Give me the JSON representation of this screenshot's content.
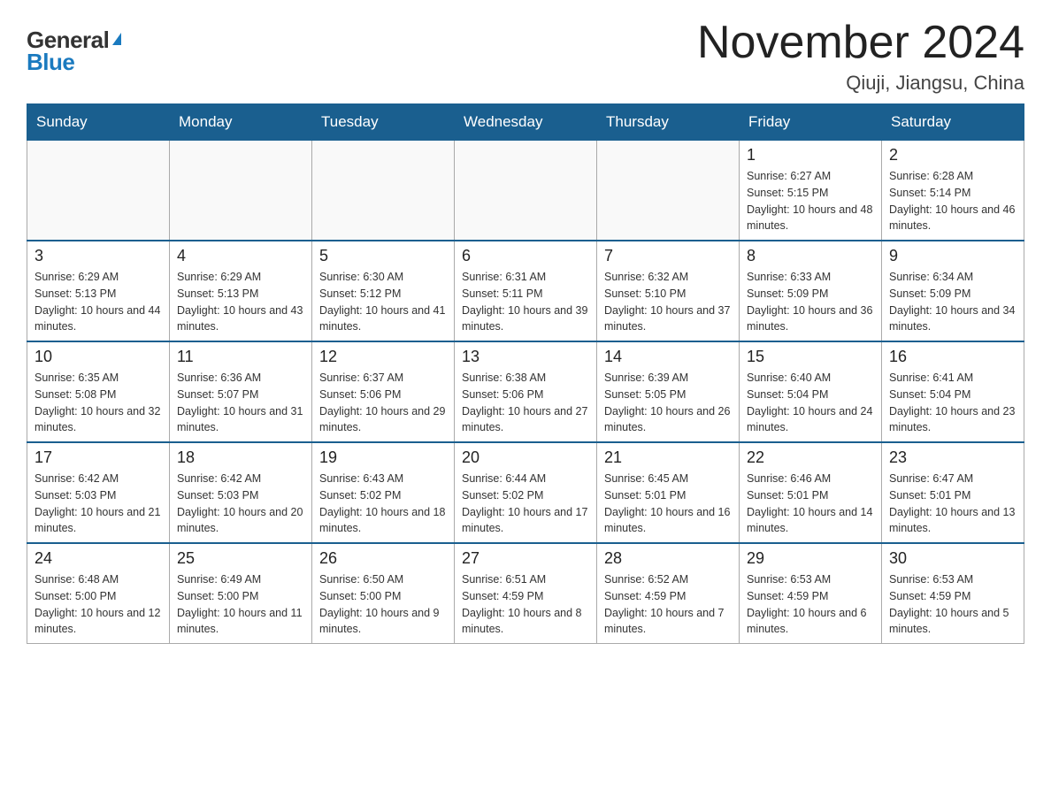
{
  "header": {
    "logo_general": "General",
    "logo_blue": "Blue",
    "month_title": "November 2024",
    "location": "Qiuji, Jiangsu, China"
  },
  "days_of_week": [
    "Sunday",
    "Monday",
    "Tuesday",
    "Wednesday",
    "Thursday",
    "Friday",
    "Saturday"
  ],
  "weeks": [
    [
      {
        "day": "",
        "info": ""
      },
      {
        "day": "",
        "info": ""
      },
      {
        "day": "",
        "info": ""
      },
      {
        "day": "",
        "info": ""
      },
      {
        "day": "",
        "info": ""
      },
      {
        "day": "1",
        "info": "Sunrise: 6:27 AM\nSunset: 5:15 PM\nDaylight: 10 hours and 48 minutes."
      },
      {
        "day": "2",
        "info": "Sunrise: 6:28 AM\nSunset: 5:14 PM\nDaylight: 10 hours and 46 minutes."
      }
    ],
    [
      {
        "day": "3",
        "info": "Sunrise: 6:29 AM\nSunset: 5:13 PM\nDaylight: 10 hours and 44 minutes."
      },
      {
        "day": "4",
        "info": "Sunrise: 6:29 AM\nSunset: 5:13 PM\nDaylight: 10 hours and 43 minutes."
      },
      {
        "day": "5",
        "info": "Sunrise: 6:30 AM\nSunset: 5:12 PM\nDaylight: 10 hours and 41 minutes."
      },
      {
        "day": "6",
        "info": "Sunrise: 6:31 AM\nSunset: 5:11 PM\nDaylight: 10 hours and 39 minutes."
      },
      {
        "day": "7",
        "info": "Sunrise: 6:32 AM\nSunset: 5:10 PM\nDaylight: 10 hours and 37 minutes."
      },
      {
        "day": "8",
        "info": "Sunrise: 6:33 AM\nSunset: 5:09 PM\nDaylight: 10 hours and 36 minutes."
      },
      {
        "day": "9",
        "info": "Sunrise: 6:34 AM\nSunset: 5:09 PM\nDaylight: 10 hours and 34 minutes."
      }
    ],
    [
      {
        "day": "10",
        "info": "Sunrise: 6:35 AM\nSunset: 5:08 PM\nDaylight: 10 hours and 32 minutes."
      },
      {
        "day": "11",
        "info": "Sunrise: 6:36 AM\nSunset: 5:07 PM\nDaylight: 10 hours and 31 minutes."
      },
      {
        "day": "12",
        "info": "Sunrise: 6:37 AM\nSunset: 5:06 PM\nDaylight: 10 hours and 29 minutes."
      },
      {
        "day": "13",
        "info": "Sunrise: 6:38 AM\nSunset: 5:06 PM\nDaylight: 10 hours and 27 minutes."
      },
      {
        "day": "14",
        "info": "Sunrise: 6:39 AM\nSunset: 5:05 PM\nDaylight: 10 hours and 26 minutes."
      },
      {
        "day": "15",
        "info": "Sunrise: 6:40 AM\nSunset: 5:04 PM\nDaylight: 10 hours and 24 minutes."
      },
      {
        "day": "16",
        "info": "Sunrise: 6:41 AM\nSunset: 5:04 PM\nDaylight: 10 hours and 23 minutes."
      }
    ],
    [
      {
        "day": "17",
        "info": "Sunrise: 6:42 AM\nSunset: 5:03 PM\nDaylight: 10 hours and 21 minutes."
      },
      {
        "day": "18",
        "info": "Sunrise: 6:42 AM\nSunset: 5:03 PM\nDaylight: 10 hours and 20 minutes."
      },
      {
        "day": "19",
        "info": "Sunrise: 6:43 AM\nSunset: 5:02 PM\nDaylight: 10 hours and 18 minutes."
      },
      {
        "day": "20",
        "info": "Sunrise: 6:44 AM\nSunset: 5:02 PM\nDaylight: 10 hours and 17 minutes."
      },
      {
        "day": "21",
        "info": "Sunrise: 6:45 AM\nSunset: 5:01 PM\nDaylight: 10 hours and 16 minutes."
      },
      {
        "day": "22",
        "info": "Sunrise: 6:46 AM\nSunset: 5:01 PM\nDaylight: 10 hours and 14 minutes."
      },
      {
        "day": "23",
        "info": "Sunrise: 6:47 AM\nSunset: 5:01 PM\nDaylight: 10 hours and 13 minutes."
      }
    ],
    [
      {
        "day": "24",
        "info": "Sunrise: 6:48 AM\nSunset: 5:00 PM\nDaylight: 10 hours and 12 minutes."
      },
      {
        "day": "25",
        "info": "Sunrise: 6:49 AM\nSunset: 5:00 PM\nDaylight: 10 hours and 11 minutes."
      },
      {
        "day": "26",
        "info": "Sunrise: 6:50 AM\nSunset: 5:00 PM\nDaylight: 10 hours and 9 minutes."
      },
      {
        "day": "27",
        "info": "Sunrise: 6:51 AM\nSunset: 4:59 PM\nDaylight: 10 hours and 8 minutes."
      },
      {
        "day": "28",
        "info": "Sunrise: 6:52 AM\nSunset: 4:59 PM\nDaylight: 10 hours and 7 minutes."
      },
      {
        "day": "29",
        "info": "Sunrise: 6:53 AM\nSunset: 4:59 PM\nDaylight: 10 hours and 6 minutes."
      },
      {
        "day": "30",
        "info": "Sunrise: 6:53 AM\nSunset: 4:59 PM\nDaylight: 10 hours and 5 minutes."
      }
    ]
  ]
}
